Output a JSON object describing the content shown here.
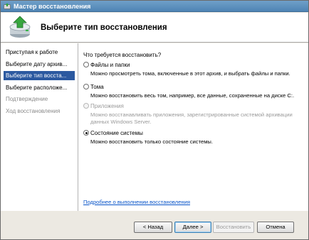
{
  "window": {
    "title": "Мастер восстановления",
    "app_icon": "recovery-wizard-icon"
  },
  "header": {
    "heading": "Выберите тип восстановления",
    "icon": "recovery-disk-arrow-icon"
  },
  "nav": {
    "items": [
      {
        "label": "Приступая к работе",
        "state": "normal"
      },
      {
        "label": "Выберите дату архив...",
        "state": "normal"
      },
      {
        "label": "Выберите тип восста...",
        "state": "active"
      },
      {
        "label": "Выберите расположе...",
        "state": "normal"
      },
      {
        "label": "Подтверждение",
        "state": "disabled"
      },
      {
        "label": "Ход восстановления",
        "state": "disabled"
      }
    ]
  },
  "main": {
    "question": "Что требуется восстановить?",
    "options": [
      {
        "label": "Файлы и папки",
        "description": "Можно просмотреть тома, включенные в этот архив, и выбрать файлы и папки.",
        "checked": false,
        "disabled": false
      },
      {
        "label": "Тома",
        "description": "Можно восстановить весь том, например, все данные, сохраненные на диске C:.",
        "checked": false,
        "disabled": false
      },
      {
        "label": "Приложения",
        "description_line1": "Можно восстанавливать приложения, зарегистрированные системой архивации",
        "description_line2": "данных Windows Server.",
        "checked": false,
        "disabled": true
      },
      {
        "label": "Состояние системы",
        "description": "Можно восстановить только состояние системы.",
        "checked": true,
        "disabled": false
      }
    ],
    "help_link": "Подробнее о выполнении восстановления"
  },
  "buttons": {
    "back": "< Назад",
    "next": "Далее >",
    "recover": "Восстановить",
    "cancel": "Отмена"
  },
  "colors": {
    "accent": "#2c59a0",
    "link": "#0a55c9",
    "titlebar": "#5a8fbd"
  }
}
